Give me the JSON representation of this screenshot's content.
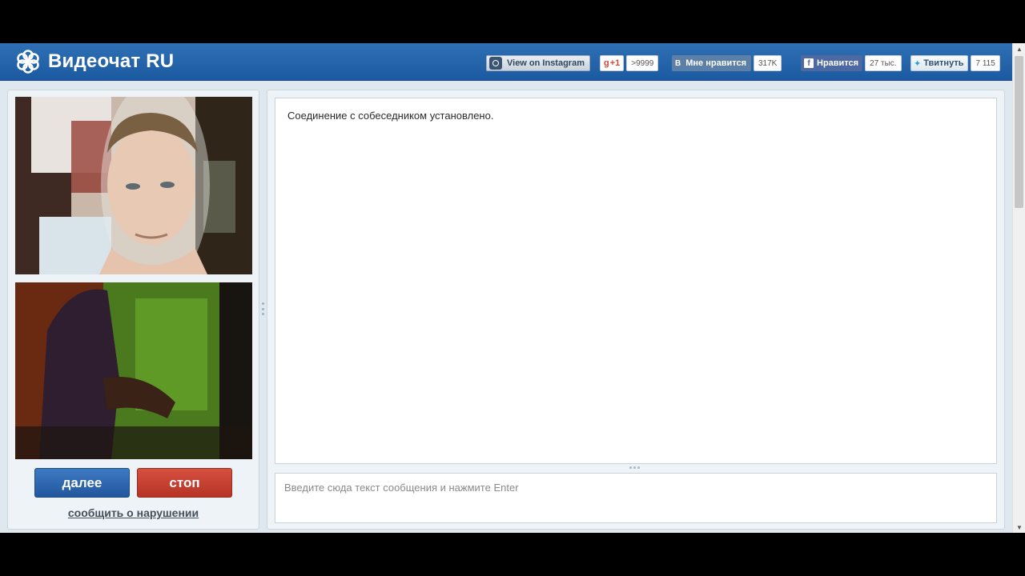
{
  "header": {
    "logo_text": "Видеочат RU",
    "logo_icon": "flower-icon",
    "instagram": {
      "label": "View on Instagram",
      "icon": "instagram-icon"
    },
    "gplus": {
      "label": "+1",
      "count": ">9999"
    },
    "vk": {
      "letter": "B",
      "label": "Мне нравится",
      "count": "317K"
    },
    "facebook": {
      "letter": "f",
      "label": "Нравится",
      "count": "27 тыс."
    },
    "twitter": {
      "label": "Твитнуть",
      "count": "7 115",
      "icon": "twitter-bird-icon"
    }
  },
  "controls": {
    "next_label": "далее",
    "stop_label": "стоп",
    "report_label": "сообщить о нарушении"
  },
  "chat": {
    "messages": [
      "Соединение с собеседником установлено."
    ],
    "input_placeholder": "Введите сюда текст сообщения и нажмите Enter"
  },
  "colors": {
    "header": "#1f5fa6",
    "next_button": "#2d66b0",
    "stop_button": "#c4402f"
  }
}
